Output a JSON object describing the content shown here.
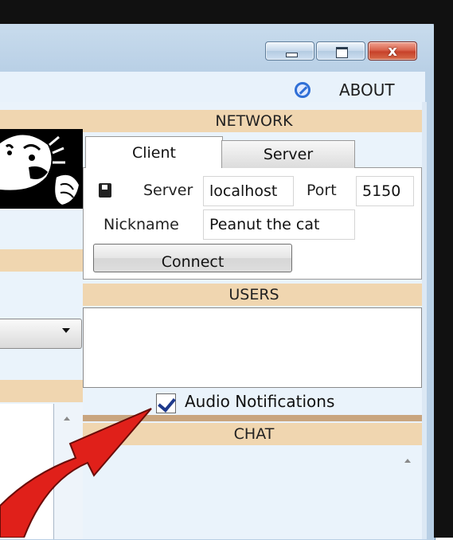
{
  "window": {
    "caption_buttons": {
      "minimize": "minimize-icon",
      "maximize": "maximize-icon",
      "close_glyph": "x"
    },
    "about_label": "ABOUT",
    "about_icon": "no-entry-icon"
  },
  "network": {
    "header": "NETWORK",
    "tabs": [
      {
        "label": "Client",
        "selected": true
      },
      {
        "label": "Server",
        "selected": false
      }
    ],
    "server_label": "Server",
    "server_value": "localhost",
    "port_label": "Port",
    "port_value": "5150",
    "nickname_label": "Nickname",
    "nickname_value": "Peanut the cat",
    "connect_label": "Connect",
    "save_icon": "floppy-icon"
  },
  "users": {
    "header": "USERS",
    "items": []
  },
  "notifications": {
    "label": "Audio Notifications",
    "checked": true
  },
  "chat": {
    "header": "CHAT"
  },
  "annotation": {
    "color": "#e0201a"
  },
  "colors": {
    "section_header": "#f0d6b0",
    "glass": "#b9d0e6",
    "close_button": "#c7412a"
  }
}
